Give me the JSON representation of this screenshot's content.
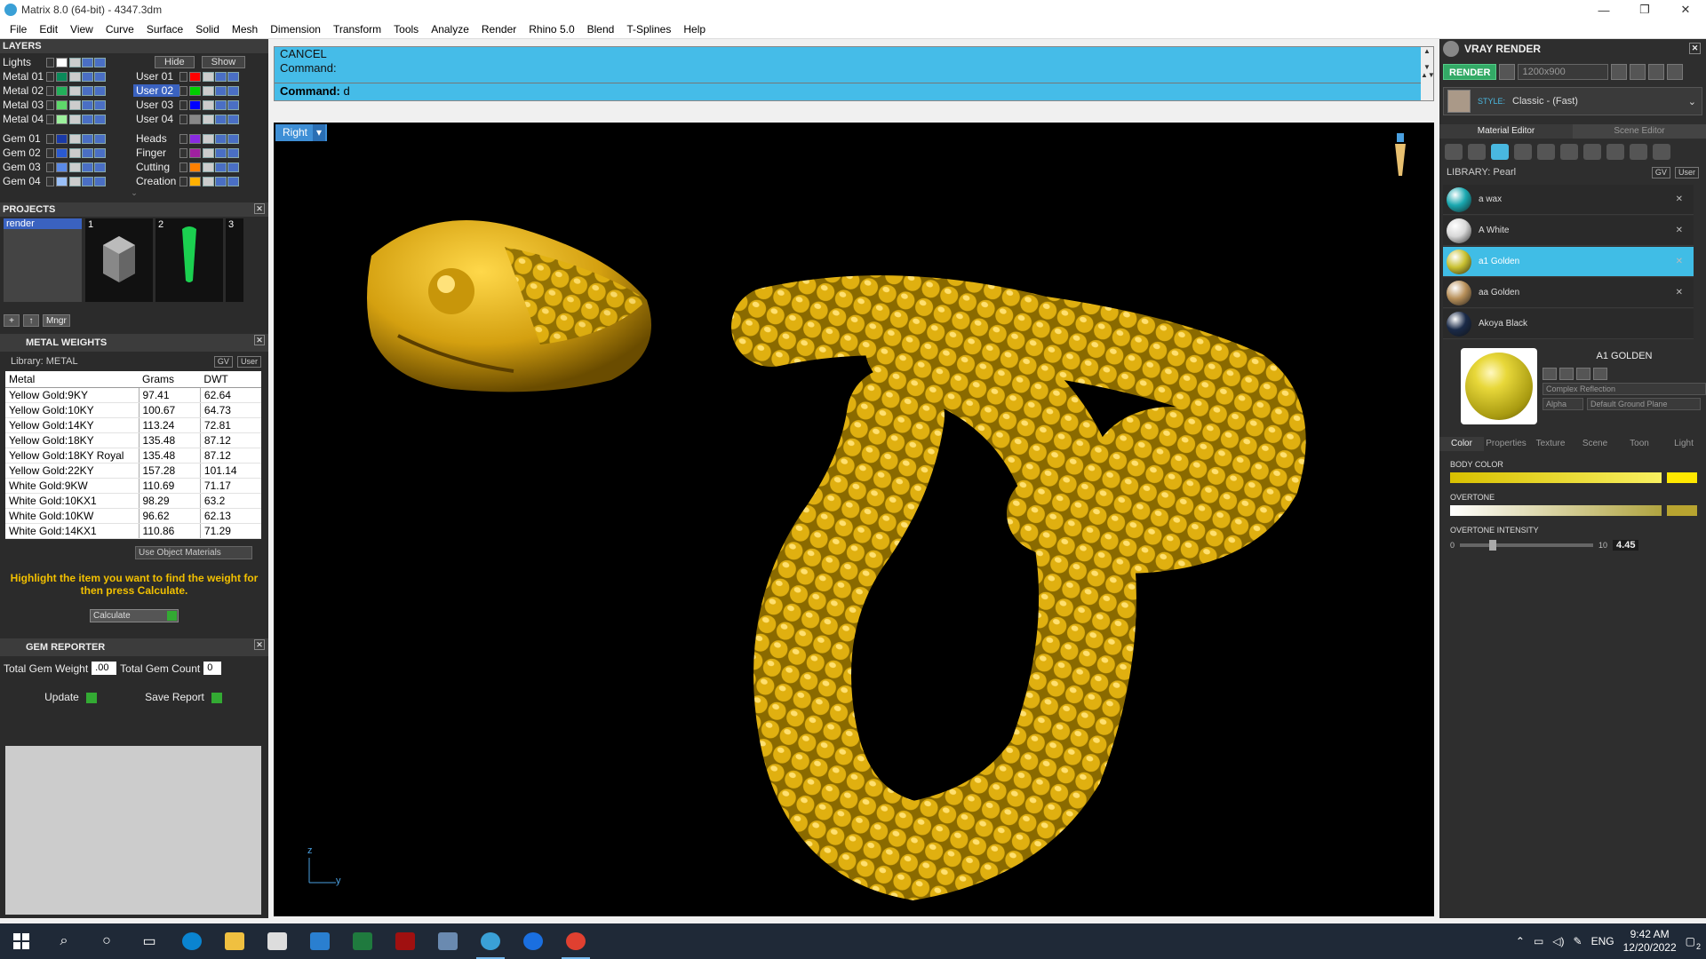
{
  "window": {
    "title": "Matrix 8.0 (64-bit) - 4347.3dm",
    "minimize": "—",
    "restore": "❐",
    "close": "✕"
  },
  "menu": [
    "File",
    "Edit",
    "View",
    "Curve",
    "Surface",
    "Solid",
    "Mesh",
    "Dimension",
    "Transform",
    "Tools",
    "Analyze",
    "Render",
    "Rhino 5.0",
    "Blend",
    "T-Splines",
    "Help"
  ],
  "layers": {
    "title": "LAYERS",
    "hide": "Hide",
    "show": "Show",
    "left": [
      {
        "name": "Lights",
        "color": "#ffffff"
      },
      {
        "name": "Metal 01",
        "color": "#0b8a5a"
      },
      {
        "name": "Metal 02",
        "color": "#22b05a"
      },
      {
        "name": "Metal 03",
        "color": "#5ed86a"
      },
      {
        "name": "Metal 04",
        "color": "#9cf09c"
      },
      {
        "name": "Gem 01",
        "color": "#1a3aa8"
      },
      {
        "name": "Gem 02",
        "color": "#2a5ad0"
      },
      {
        "name": "Gem 03",
        "color": "#5a8ae8"
      },
      {
        "name": "Gem 04",
        "color": "#9ac0f8"
      }
    ],
    "right": [
      {
        "name": "User 01",
        "color": "#ff0000",
        "selected": false
      },
      {
        "name": "User 02",
        "color": "#00d000",
        "selected": true
      },
      {
        "name": "User 03",
        "color": "#0000ff",
        "selected": false
      },
      {
        "name": "User 04",
        "color": "#888888",
        "selected": false
      },
      {
        "name": "Heads",
        "color": "#8a2be2",
        "selected": false
      },
      {
        "name": "Finger",
        "color": "#a020a0",
        "selected": false
      },
      {
        "name": "Cutting",
        "color": "#ff8000",
        "selected": false
      },
      {
        "name": "Creation",
        "color": "#ffb000",
        "selected": false
      }
    ]
  },
  "projects": {
    "title": "PROJECTS",
    "list_item": "render",
    "thumbs": [
      "1",
      "2",
      "3"
    ],
    "mngr": "Mngr"
  },
  "metal": {
    "title": "METAL WEIGHTS",
    "library": "Library: METAL",
    "gv": "GV",
    "user": "User",
    "headers": [
      "Metal",
      "Grams",
      "DWT"
    ],
    "rows": [
      [
        "Yellow Gold:9KY",
        "97.41",
        "62.64"
      ],
      [
        "Yellow Gold:10KY",
        "100.67",
        "64.73"
      ],
      [
        "Yellow Gold:14KY",
        "113.24",
        "72.81"
      ],
      [
        "Yellow Gold:18KY",
        "135.48",
        "87.12"
      ],
      [
        "Yellow Gold:18KY Royal",
        "135.48",
        "87.12"
      ],
      [
        "Yellow Gold:22KY",
        "157.28",
        "101.14"
      ],
      [
        "White Gold:9KW",
        "110.69",
        "71.17"
      ],
      [
        "White Gold:10KX1",
        "98.29",
        "63.2"
      ],
      [
        "White Gold:10KW",
        "96.62",
        "62.13"
      ],
      [
        "White Gold:14KX1",
        "110.86",
        "71.29"
      ]
    ],
    "use_object": "Use Object Materials",
    "message": "Highlight the item you want to find the weight for then press Calculate.",
    "calculate": "Calculate"
  },
  "gem": {
    "title": "GEM REPORTER",
    "weight_label": "Total Gem Weight",
    "weight_value": ".00",
    "count_label": "Total Gem Count",
    "count_value": "0",
    "update": "Update",
    "save": "Save Report"
  },
  "command": {
    "line1": "CANCEL",
    "line2": "Command:",
    "prompt": "Command:",
    "input": "d"
  },
  "viewport": {
    "label": "Right",
    "axis_z": "z",
    "axis_y": "y"
  },
  "vray": {
    "title": "VRAY RENDER",
    "render": "RENDER",
    "resolution": "1200x900",
    "style_label": "STYLE:",
    "style_value": "Classic - (Fast)",
    "tabs": [
      "Material Editor",
      "Scene Editor"
    ],
    "library": "LIBRARY: Pearl",
    "gv": "GV",
    "user": "User",
    "materials": [
      {
        "name": "a wax",
        "color": "#1aa8b0",
        "selected": false
      },
      {
        "name": "A White",
        "color": "#d8d8d8",
        "selected": false
      },
      {
        "name": "a1 Golden",
        "color": "#c8c030",
        "selected": true
      },
      {
        "name": "aa Golden",
        "color": "#b8905a",
        "selected": false
      },
      {
        "name": "Akoya Black",
        "color": "#1a2a48",
        "selected": false
      }
    ],
    "current_material": "A1 GOLDEN",
    "reflection": "Complex Reflection",
    "alpha": "Alpha",
    "ground": "Default Ground Plane",
    "prop_tabs": [
      "Color",
      "Properties",
      "Texture",
      "Scene",
      "Toon",
      "Light"
    ],
    "body_color": "BODY COLOR",
    "overtone": "OVERTONE",
    "overtone_intensity": "OVERTONE INTENSITY",
    "slider_min": "0",
    "slider_max": "10",
    "slider_value": "4.45"
  },
  "taskbar": {
    "lang": "ENG",
    "time": "9:42 AM",
    "date": "12/20/2022",
    "notif": "2"
  },
  "colors": {
    "accent": "#45bce8",
    "gold": "#d4a810"
  }
}
